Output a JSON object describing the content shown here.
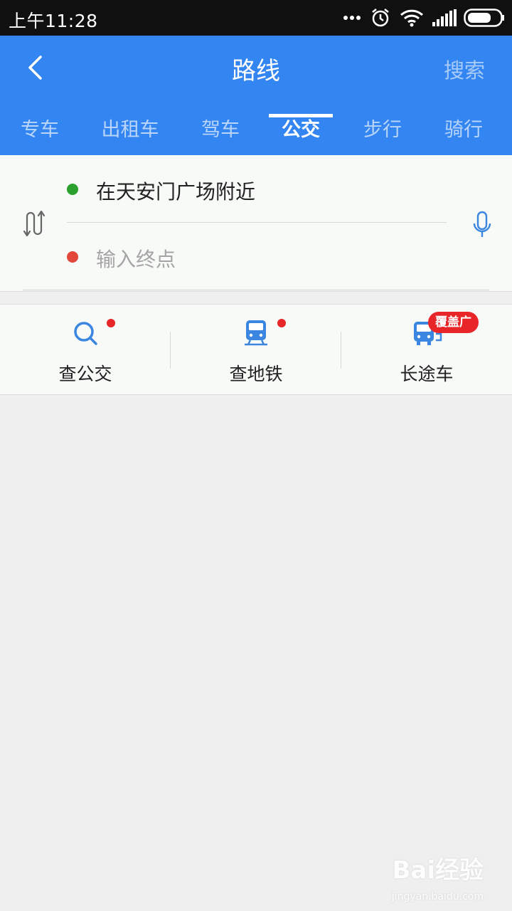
{
  "status_bar": {
    "time": "上午11:28"
  },
  "header": {
    "title": "路线",
    "search_label": "搜索"
  },
  "tabs": [
    {
      "label": "专车",
      "active": false
    },
    {
      "label": "出租车",
      "active": false
    },
    {
      "label": "驾车",
      "active": false
    },
    {
      "label": "公交",
      "active": true
    },
    {
      "label": "步行",
      "active": false
    },
    {
      "label": "骑行",
      "active": false
    }
  ],
  "route": {
    "start": "在天安门广场附近",
    "end_placeholder": "输入终点"
  },
  "tools": [
    {
      "label": "查公交",
      "icon": "search-icon",
      "has_dot": true
    },
    {
      "label": "查地铁",
      "icon": "subway-icon",
      "has_dot": true
    },
    {
      "label": "长途车",
      "icon": "coach-bus-icon",
      "badge": "覆盖广"
    }
  ],
  "watermark": {
    "brand": "Bai经验",
    "url": "jingyan.baidu.com"
  },
  "colors": {
    "primary": "#3385f2",
    "start_dot": "#2ca02c",
    "end_dot": "#e3463a",
    "badge": "#e8262a",
    "icon_blue": "#3a86e0"
  }
}
